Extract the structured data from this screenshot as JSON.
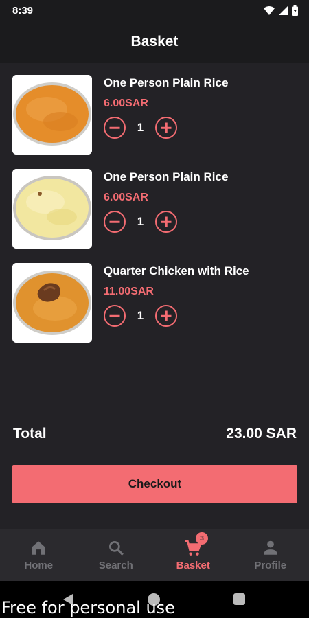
{
  "status_bar": {
    "time": "8:39"
  },
  "header": {
    "title": "Basket"
  },
  "basket": {
    "items": [
      {
        "name": "One Person Plain Rice",
        "price": "6.00SAR",
        "quantity": "1",
        "image": "orange-rice-plate"
      },
      {
        "name": "One Person Plain Rice",
        "price": "6.00SAR",
        "quantity": "1",
        "image": "yellow-rice-plate"
      },
      {
        "name": "Quarter Chicken with Rice",
        "price": "11.00SAR",
        "quantity": "1",
        "image": "chicken-rice-plate"
      }
    ]
  },
  "summary": {
    "total_label": "Total",
    "total_value": "23.00 SAR"
  },
  "checkout": {
    "label": "Checkout"
  },
  "bottom_nav": {
    "items": [
      {
        "label": "Home",
        "icon": "home-icon"
      },
      {
        "label": "Search",
        "icon": "search-icon"
      },
      {
        "label": "Basket",
        "icon": "cart-icon",
        "badge": "3",
        "active": true
      },
      {
        "label": "Profile",
        "icon": "person-icon"
      }
    ]
  },
  "watermark": "Free for personal use",
  "colors": {
    "accent": "#f36c72",
    "background": "#232226",
    "bar": "#1b1b1d",
    "nav": "#2b2a2e"
  }
}
